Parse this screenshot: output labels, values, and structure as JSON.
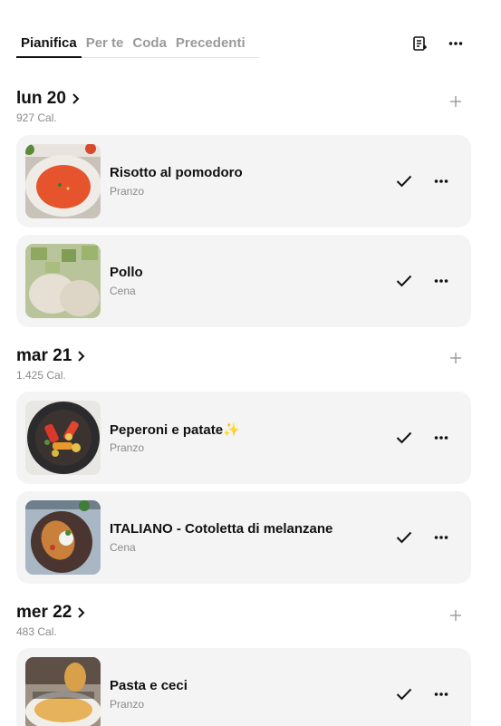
{
  "tabs": [
    {
      "label": "Pianifica",
      "active": true
    },
    {
      "label": "Per te",
      "active": false
    },
    {
      "label": "Coda",
      "active": false
    },
    {
      "label": "Precedenti",
      "active": false
    }
  ],
  "toolbar": {
    "list_icon": "shopping-list-icon",
    "more_icon": "more-horizontal-icon"
  },
  "days": [
    {
      "title": "lun 20",
      "calories": "927 Cal.",
      "meals": [
        {
          "title": "Risotto al pomodoro",
          "type": "Pranzo",
          "image": "tomato-risotto-image"
        },
        {
          "title": "Pollo",
          "type": "Cena",
          "image": "chicken-image"
        }
      ]
    },
    {
      "title": "mar 21",
      "calories": "1.425 Cal.",
      "meals": [
        {
          "title": "Peperoni e patate✨",
          "type": "Pranzo",
          "image": "peppers-potatoes-image"
        },
        {
          "title": "ITALIANO - Cotoletta di melanzane",
          "type": "Cena",
          "image": "eggplant-cutlet-image"
        }
      ]
    },
    {
      "title": "mer 22",
      "calories": "483 Cal.",
      "meals": [
        {
          "title": "Pasta e ceci",
          "type": "Pranzo",
          "image": "pasta-chickpeas-image"
        }
      ]
    }
  ],
  "colors": {
    "card_bg": "#f4f4f4",
    "muted_text": "#8a8a8a",
    "active_tab": "#111111"
  }
}
